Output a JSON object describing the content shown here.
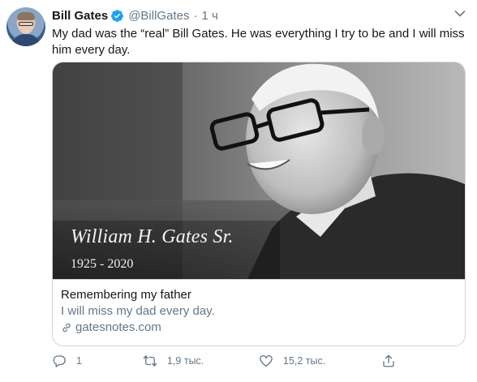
{
  "author": {
    "name": "Bill Gates",
    "handle": "@BillGates",
    "separator": "·",
    "time": "1 ч"
  },
  "tweet": {
    "text": "My dad was the “real” Bill Gates. He was everything I try to be and I will miss him every day."
  },
  "card": {
    "image_title": "William H. Gates Sr.",
    "image_years": "1925 - 2020",
    "title": "Remembering my father",
    "description": "I will miss my dad every day.",
    "domain": "gatesnotes.com"
  },
  "actions": {
    "replies": "1",
    "retweets": "1,9 тыс.",
    "likes": "15,2 тыс."
  },
  "icons": [
    "verified-badge-icon",
    "caret-down-icon",
    "link-icon",
    "reply-icon",
    "retweet-icon",
    "like-icon",
    "share-icon"
  ],
  "colors": {
    "text": "#14171a",
    "secondary": "#657786",
    "verified": "#1da1f2",
    "border": "#ccd6dd"
  }
}
